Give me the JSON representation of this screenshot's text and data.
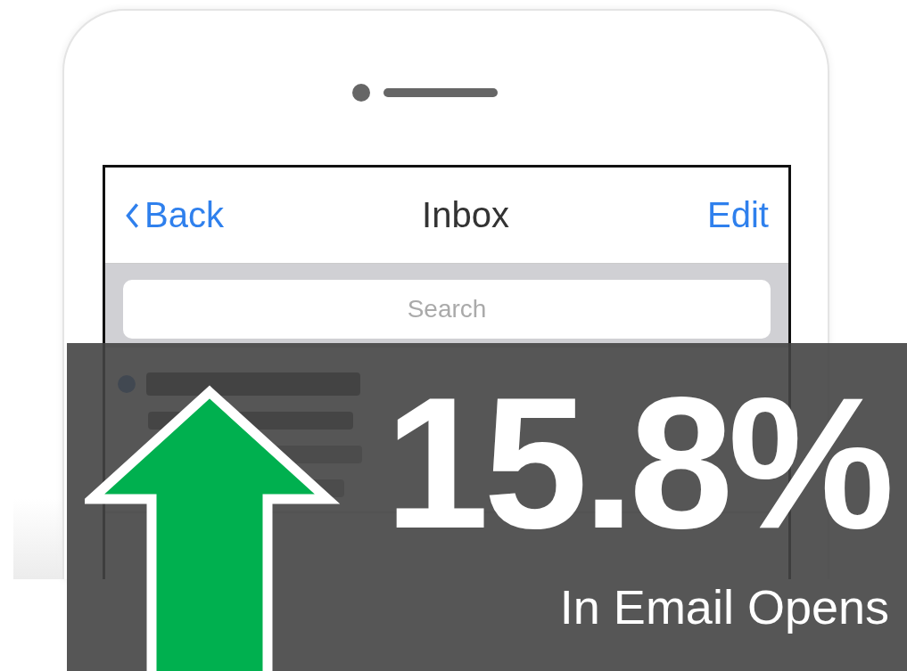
{
  "screen": {
    "back": "Back",
    "title": "Inbox",
    "edit": "Edit",
    "search": {
      "placeholder": "Search"
    },
    "messages": [
      {
        "unread": true
      }
    ]
  },
  "overlay": {
    "figure": "15.8%",
    "caption": "In Email Opens"
  }
}
